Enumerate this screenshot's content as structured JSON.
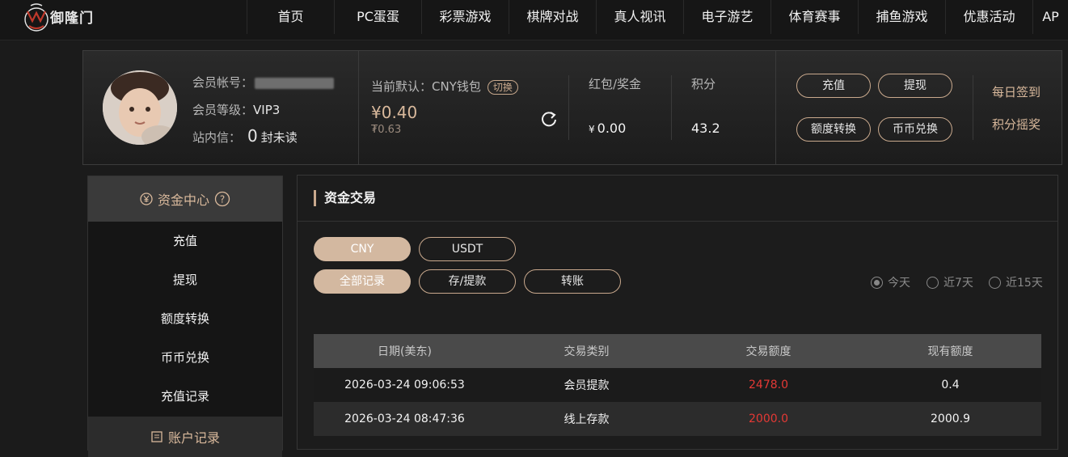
{
  "brand": {
    "name": "御隆门",
    "logo_letters": "YLM"
  },
  "nav": [
    "首页",
    "PC蛋蛋",
    "彩票游戏",
    "棋牌对战",
    "真人视讯",
    "电子游艺",
    "体育赛事",
    "捕鱼游戏",
    "优惠活动",
    "AP"
  ],
  "account": {
    "member_label": "会员帐号：",
    "level_label": "会员等级：",
    "level_value": "VIP3",
    "inbox_label": "站内信：",
    "unread_count": "0",
    "unread_text": "封未读",
    "wallet_label": "当前默认：CNY钱包",
    "switch_label": "切换",
    "balance": "¥0.40",
    "balance_sub": "₮0.63",
    "redpacket_label": "红包/奖金",
    "redpacket_currency": "¥",
    "redpacket_value": "0.00",
    "points_label": "积分",
    "points_value": "43.2",
    "actions": [
      "充值",
      "提现",
      "额度转换",
      "币币兑换"
    ],
    "links": [
      "每日签到",
      "积分摇奖"
    ]
  },
  "sidebar": {
    "heading": "资金中心",
    "items": [
      "充值",
      "提现",
      "额度转换",
      "币币兑换",
      "充值记录"
    ],
    "heading2": "账户记录"
  },
  "main": {
    "title": "资金交易",
    "currency_tabs": [
      "CNY",
      "USDT"
    ],
    "type_tabs": [
      "全部记录",
      "存/提款",
      "转账"
    ],
    "range_options": [
      "今天",
      "近7天",
      "近15天"
    ],
    "columns": [
      "日期(美东)",
      "交易类别",
      "交易额度",
      "现有额度"
    ],
    "rows": [
      {
        "date": "2026-03-24 09:06:53",
        "type": "会员提款",
        "amount": "2478.0",
        "balance": "0.4"
      },
      {
        "date": "2026-03-24 08:47:36",
        "type": "线上存款",
        "amount": "2000.0",
        "balance": "2000.9"
      }
    ]
  },
  "colors": {
    "accent": "#c9a98d",
    "active_tab": "#d3b8a0",
    "amount": "#e53935"
  }
}
